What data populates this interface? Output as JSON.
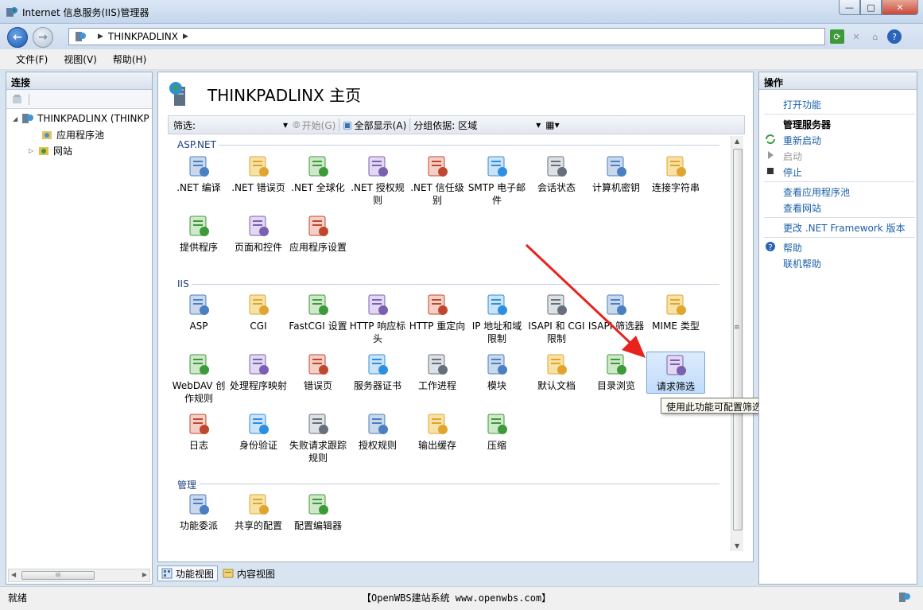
{
  "window": {
    "title": "Internet 信息服务(IIS)管理器",
    "minimize": "—",
    "maximize": "□",
    "close": "✕"
  },
  "address": {
    "sep1": "▶",
    "server": "THINKPADLINX",
    "sep2": "▶"
  },
  "menu": [
    "文件(F)",
    "视图(V)",
    "帮助(H)"
  ],
  "connections": {
    "header": "连接",
    "tree": [
      {
        "label": "THINKPADLINX (THINKP",
        "expander": "◢",
        "icon": "server-icon"
      },
      {
        "label": "应用程序池",
        "expander": "",
        "icon": "app-pool-icon"
      },
      {
        "label": "网站",
        "expander": "▷",
        "icon": "sites-icon"
      }
    ],
    "scroll_grip": "III",
    "scroll_left": "◀",
    "scroll_right": "▶"
  },
  "main": {
    "title": "THINKPADLINX 主页",
    "filter_label": "筛选:",
    "filter_arrow": "▾",
    "start_label": "开始(G)",
    "show_all_label": "全部显示(A)",
    "group_by_label": "分组依据:",
    "group_by_value": "区域",
    "groups": {
      "aspnet": "ASP.NET",
      "iis": "IIS",
      "manage": "管理"
    },
    "aspnet_features": [
      ".NET 编译",
      ".NET 错误页",
      ".NET 全球化",
      ".NET 授权规则",
      ".NET 信任级别",
      "SMTP 电子邮件",
      "会话状态",
      "计算机密钥",
      "连接字符串",
      "提供程序",
      "页面和控件",
      "应用程序设置"
    ],
    "iis_features": [
      "ASP",
      "CGI",
      "FastCGI 设置",
      "HTTP 响应标头",
      "HTTP 重定向",
      "IP 地址和域限制",
      "ISAPI 和 CGI 限制",
      "ISAPI 筛选器",
      "MIME 类型",
      "WebDAV 创作规则",
      "处理程序映射",
      "错误页",
      "服务器证书",
      "工作进程",
      "模块",
      "默认文档",
      "目录浏览",
      "请求筛选",
      "日志",
      "身份验证",
      "失败请求跟踪规则",
      "授权规则",
      "输出缓存",
      "压缩"
    ],
    "manage_features": [
      "功能委派",
      "共享的配置",
      "配置编辑器"
    ],
    "selected_feature": "请求筛选",
    "scroll_grip": "≡",
    "scroll_up": "▲",
    "scroll_down": "▼"
  },
  "tooltip": "使用此功能可配置筛选规则",
  "view_tabs": [
    "功能视图",
    "内容视图"
  ],
  "actions": {
    "header": "操作",
    "open_feature": "打开功能",
    "manage_server": "管理服务器",
    "restart": "重新启动",
    "start": "启动",
    "stop": "停止",
    "view_app_pools": "查看应用程序池",
    "view_sites": "查看网站",
    "change_framework": "更改 .NET Framework 版本",
    "help": "帮助",
    "online_help": "联机帮助"
  },
  "status": {
    "text": "就绪",
    "watermark": "【OpenWBS建站系统 www.openwbs.com】"
  },
  "colors": {
    "link": "#1a5fa8",
    "annotation_arrow": "#e8231e",
    "selection": "#c1dcfc"
  }
}
